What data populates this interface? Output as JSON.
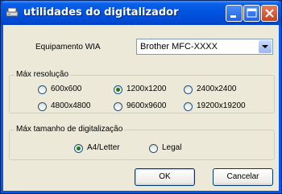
{
  "window": {
    "title": "utilidades do digitalizador"
  },
  "device": {
    "label": "Equipamento WIA",
    "selected": "Brother MFC-XXXX"
  },
  "resolution": {
    "group_title": "Máx resolução",
    "options": [
      "600x600",
      "1200x1200",
      "2400x2400",
      "4800x4800",
      "9600x9600",
      "19200x19200"
    ],
    "selected": "1200x1200"
  },
  "scan_size": {
    "group_title": "Máx tamanho de digitalização",
    "options": [
      "A4/Letter",
      "Legal"
    ],
    "selected": "A4/Letter"
  },
  "buttons": {
    "ok": "OK",
    "cancel": "Cancelar"
  },
  "colors": {
    "titlebar": "#0053e0",
    "dialog_bg": "#ece9d8",
    "close_button": "#c8421f",
    "selected_radio": "#1f7a1f"
  }
}
